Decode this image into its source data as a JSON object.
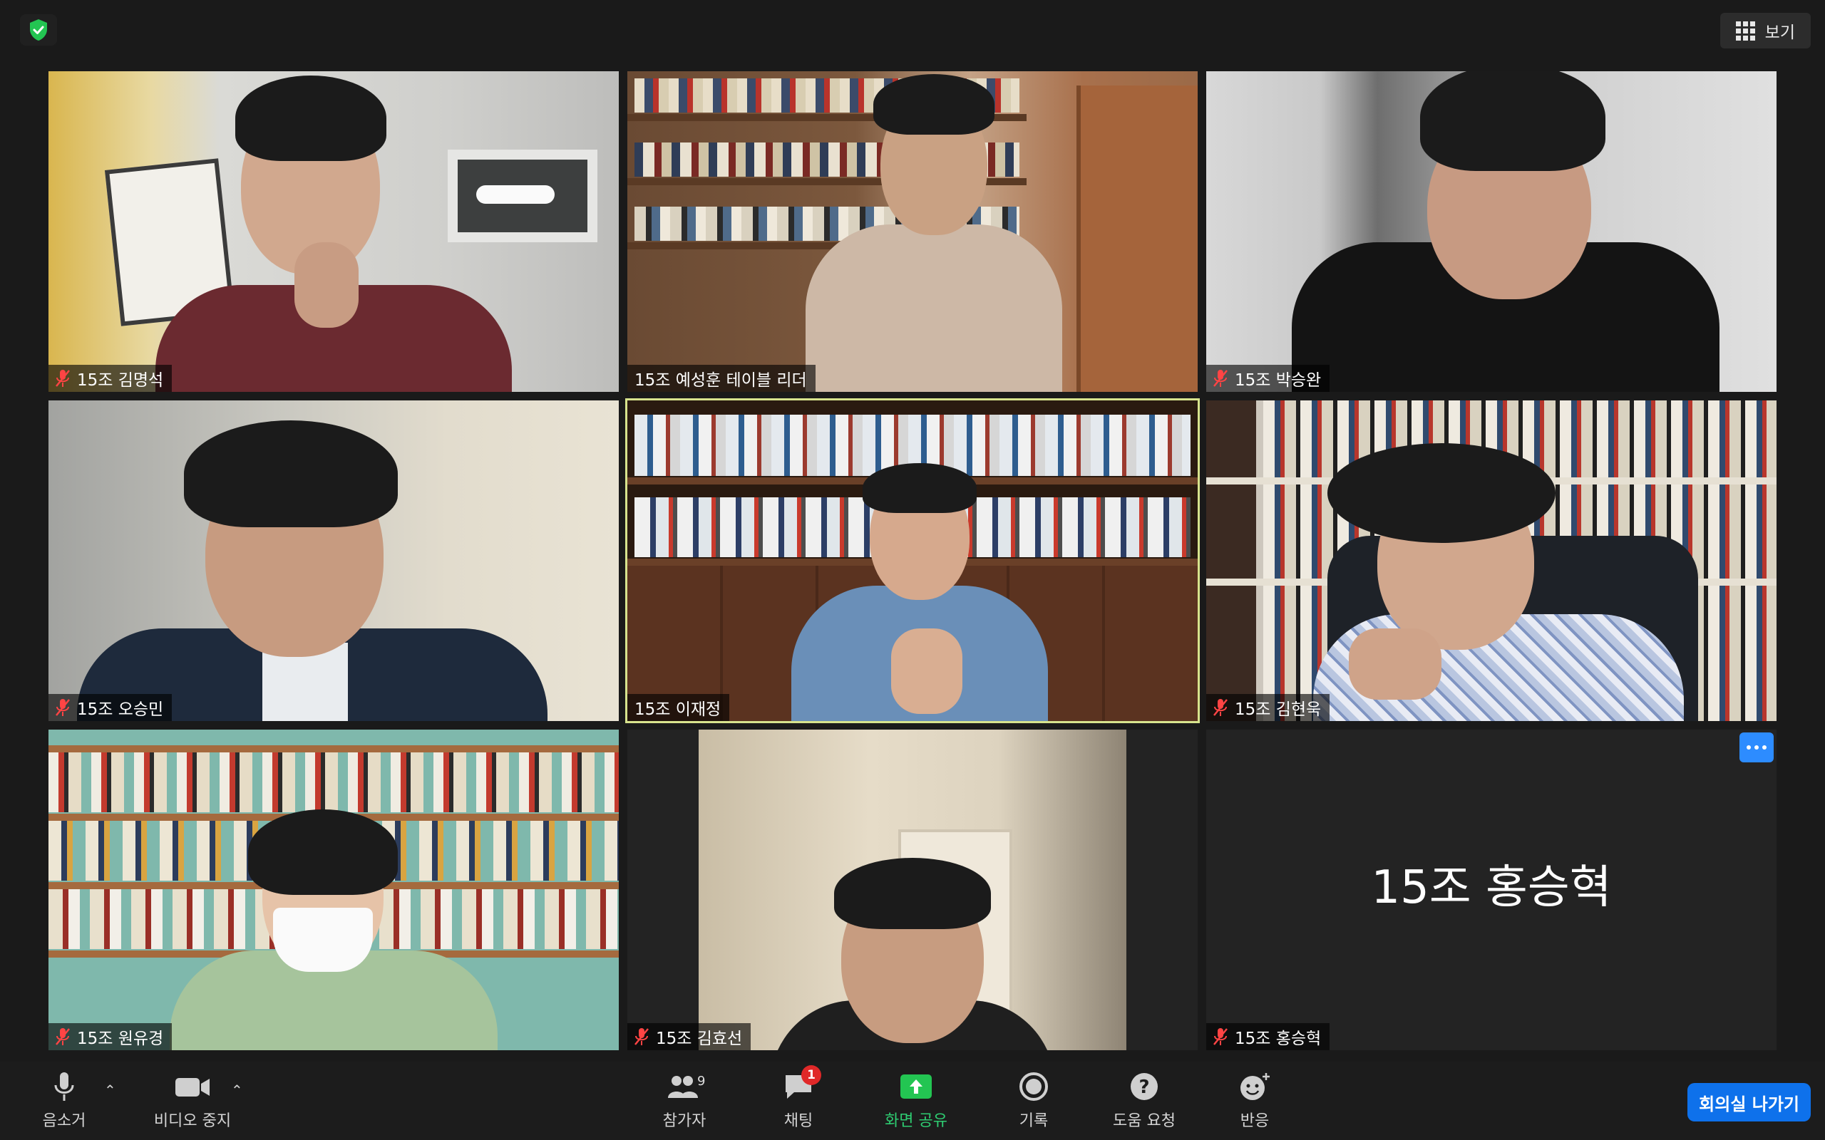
{
  "view_button": {
    "label": "보기"
  },
  "tiles": [
    {
      "name": "15조 김명석",
      "muted": true
    },
    {
      "name": "15조 예성훈 테이블 리더",
      "muted": false
    },
    {
      "name": "15조 박승완",
      "muted": true
    },
    {
      "name": "15조 오승민",
      "muted": true
    },
    {
      "name": "15조 이재정",
      "muted": false
    },
    {
      "name": "15조 김현욱",
      "muted": true
    },
    {
      "name": "15조 원유경",
      "muted": true
    },
    {
      "name": "15조 김효선",
      "muted": true
    },
    {
      "name": "15조 홍승혁",
      "muted": true,
      "video_off_label": "15조 홍승혁"
    }
  ],
  "toolbar": {
    "mute": "음소거",
    "stop_video": "비디오 중지",
    "participants": "참가자",
    "participant_count": "9",
    "chat": "채팅",
    "chat_badge": "1",
    "share_screen": "화면 공유",
    "record": "기록",
    "ask_help": "도움 요청",
    "reactions": "반응",
    "leave_room": "회의실 나가기"
  },
  "colors": {
    "active_speaker_border": "#d7e38d",
    "share_green": "#2ecc71",
    "leave_blue": "#0e71eb",
    "badge_red": "#e02828"
  }
}
